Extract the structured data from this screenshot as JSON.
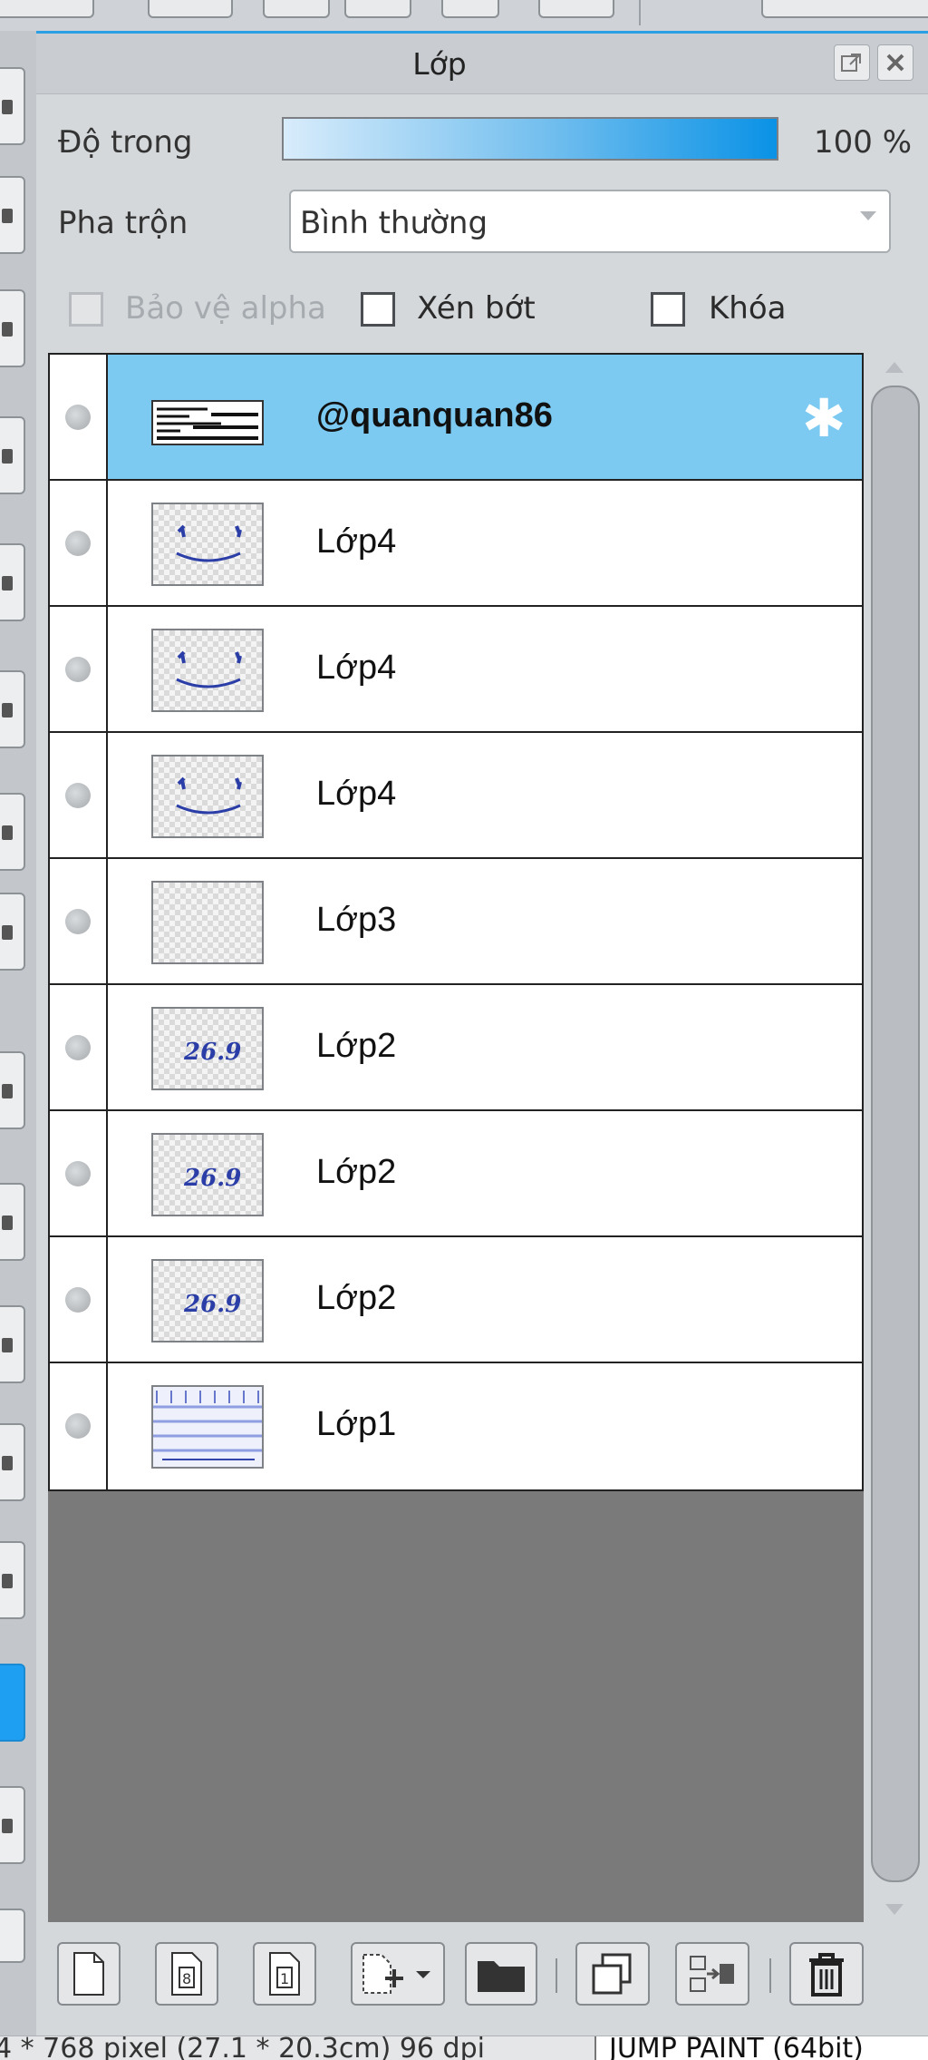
{
  "panel": {
    "title": "Lớp",
    "opacity_label": "Độ trong",
    "opacity_value": "100 %",
    "opacity_percent": 100,
    "blend_label": "Pha trộn",
    "blend_value": "Bình thường",
    "checkboxes": {
      "protect_alpha": "Bảo vệ alpha",
      "clip": "Xén bớt",
      "lock": "Khóa"
    }
  },
  "layers": [
    {
      "name": "@quanquan86",
      "selected": true,
      "thumb": "text"
    },
    {
      "name": "Lớp4",
      "thumb": "face"
    },
    {
      "name": "Lớp4",
      "thumb": "face"
    },
    {
      "name": "Lớp4",
      "thumb": "face"
    },
    {
      "name": "Lớp3",
      "thumb": "empty"
    },
    {
      "name": "Lớp2",
      "thumb": "sig"
    },
    {
      "name": "Lớp2",
      "thumb": "sig"
    },
    {
      "name": "Lớp2",
      "thumb": "sig"
    },
    {
      "name": "Lớp1",
      "thumb": "lines"
    }
  ],
  "thumb_sig_text": "26.9",
  "status": {
    "size_text": "4 * 768 pixel   (27.1 * 20.3cm)   96 dpi",
    "app_text": "JUMP PAINT (64bit)"
  },
  "colors": {
    "accent": "#1e9ff2",
    "selected_row": "#7ccaf2"
  }
}
